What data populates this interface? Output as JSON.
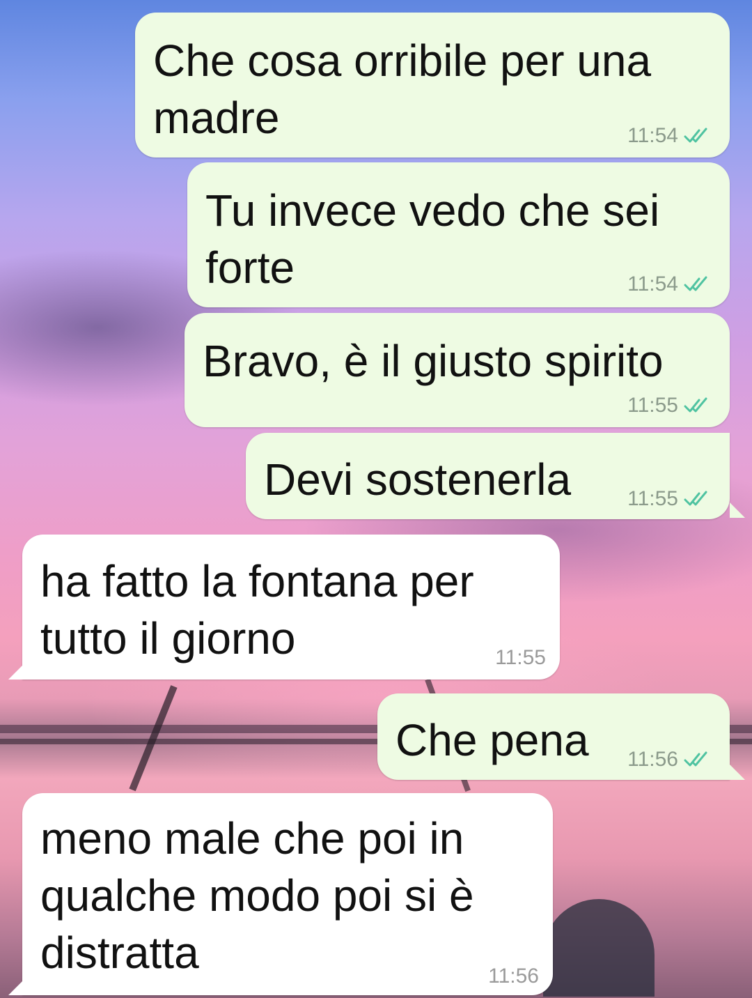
{
  "messages": [
    {
      "direction": "outgoing",
      "text": "Che cosa orribile per una\nmadre",
      "time": "11:54",
      "status_icon": "double-check-read-icon"
    },
    {
      "direction": "outgoing",
      "text": "Tu invece vedo che sei\nforte",
      "time": "11:54",
      "status_icon": "double-check-read-icon"
    },
    {
      "direction": "outgoing",
      "text": "Bravo, è il giusto spirito",
      "time": "11:55",
      "status_icon": "double-check-read-icon"
    },
    {
      "direction": "outgoing",
      "text": "Devi sostenerla",
      "time": "11:55",
      "status_icon": "double-check-read-icon"
    },
    {
      "direction": "incoming",
      "text": "ha fatto la fontana per\ntutto il giorno",
      "time": "11:55"
    },
    {
      "direction": "outgoing",
      "text": "Che pena",
      "time": "11:56",
      "status_icon": "double-check-read-icon"
    },
    {
      "direction": "incoming",
      "text": "meno male che poi in\nqualche modo poi si è\ndistratta",
      "time": "11:56"
    }
  ],
  "colors": {
    "outgoing_bubble": "#eefbe3",
    "incoming_bubble": "#ffffff",
    "read_tick": "#4fc3a1",
    "timestamp": "#8b9a8b"
  },
  "wallpaper": "sunset-sea-photo"
}
